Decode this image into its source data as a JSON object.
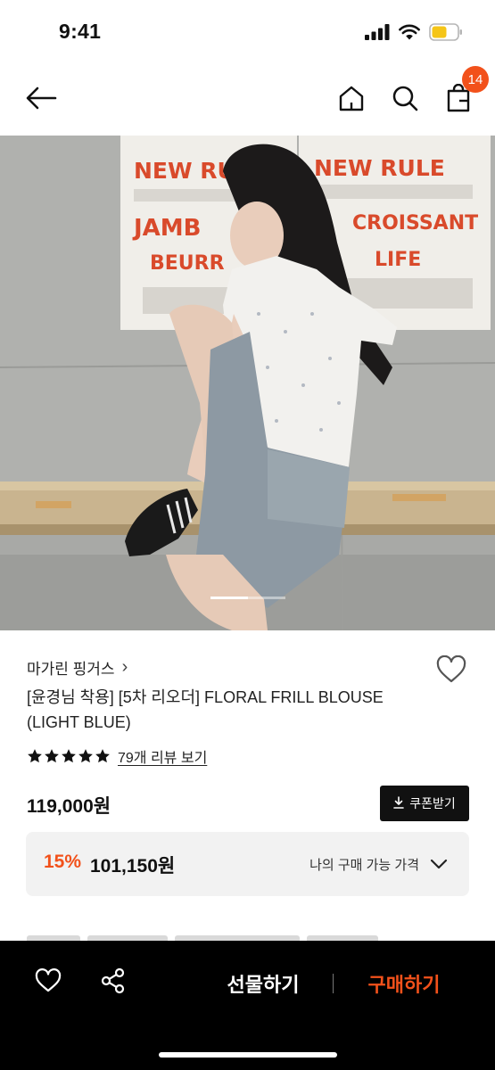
{
  "status_bar": {
    "time": "9:41"
  },
  "nav": {
    "cart_count": "14",
    "icons": [
      "back-arrow-icon",
      "home-icon",
      "search-icon",
      "cart-icon"
    ]
  },
  "hero": {
    "poster_lines_left": [
      "NEW RULE",
      "JAMB",
      "BEURR"
    ],
    "poster_lines_right": [
      "NEW RULE",
      "CROISSANT",
      "LIFE"
    ],
    "slide_progress": 0.5
  },
  "product": {
    "brand": "마가린 핑거스",
    "brand_chevron": "›",
    "name_line1": "[윤경님 착용] [5차 리오더] FLORAL FRILL BLOUSE",
    "name_line2": "(LIGHT BLUE)",
    "rating_stars": 5,
    "review_link": "79개 리뷰 보기",
    "price": "119,000원",
    "coupon_button": "쿠폰받기"
  },
  "discount": {
    "rate": "15%",
    "price": "101,150원",
    "label": "나의 구매 가능 가격"
  },
  "bottom_bar": {
    "gift_label": "선물하기",
    "buy_label": "구매하기"
  },
  "colors": {
    "accent": "#f2511b",
    "bottom_bar_bg": "#000000",
    "discount_box_bg": "#f2f2f2"
  }
}
